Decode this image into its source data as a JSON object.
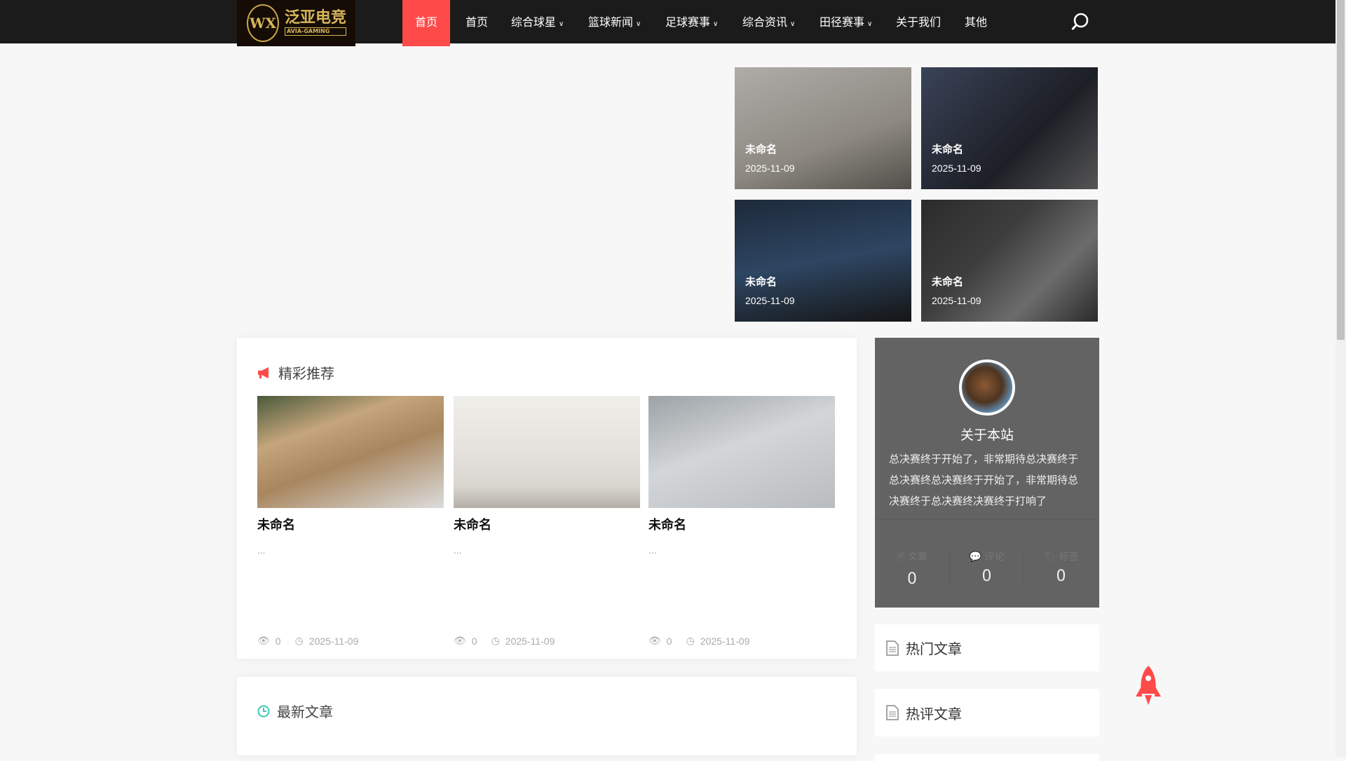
{
  "nav": {
    "logo_text": "泛亚电竞",
    "logo_sub": "AVIA-GAMING",
    "logo_mark": "WX",
    "active": "首页",
    "items": [
      {
        "label": "首页",
        "dropdown": false
      },
      {
        "label": "综合球星",
        "dropdown": true
      },
      {
        "label": "篮球新闻",
        "dropdown": true
      },
      {
        "label": "足球赛事",
        "dropdown": true
      },
      {
        "label": "综合资讯",
        "dropdown": true
      },
      {
        "label": "田径赛事",
        "dropdown": true
      },
      {
        "label": "关于我们",
        "dropdown": false
      },
      {
        "label": "其他",
        "dropdown": false
      }
    ]
  },
  "featured": [
    {
      "title": "未命名",
      "date": "2025-11-09"
    },
    {
      "title": "未命名",
      "date": "2025-11-09"
    },
    {
      "title": "未命名",
      "date": "2025-11-09"
    },
    {
      "title": "未命名",
      "date": "2025-11-09"
    }
  ],
  "recommend": {
    "title": "精彩推荐",
    "posts": [
      {
        "title": "未命名",
        "excerpt": "...",
        "views": "0",
        "date": "2025-11-09"
      },
      {
        "title": "未命名",
        "excerpt": "...",
        "views": "0",
        "date": "2025-11-09"
      },
      {
        "title": "未命名",
        "excerpt": "...",
        "views": "0",
        "date": "2025-11-09"
      }
    ]
  },
  "latest": {
    "title": "最新文章"
  },
  "about": {
    "title": "关于本站",
    "desc": "总决赛终于开始了，非常期待总决赛终于总决赛终总决赛终于开始了，非常期待总决赛终于总决赛终决赛终于打响了",
    "stats": [
      {
        "label": "文章",
        "value": "0"
      },
      {
        "label": "评论",
        "value": "0"
      },
      {
        "label": "标签",
        "value": "0"
      }
    ]
  },
  "widgets": {
    "hot": "热门文章",
    "hot_comments": "热评文章"
  },
  "colors": {
    "accent": "#ff4a4a",
    "nav_bg": "#1b1b1b"
  }
}
